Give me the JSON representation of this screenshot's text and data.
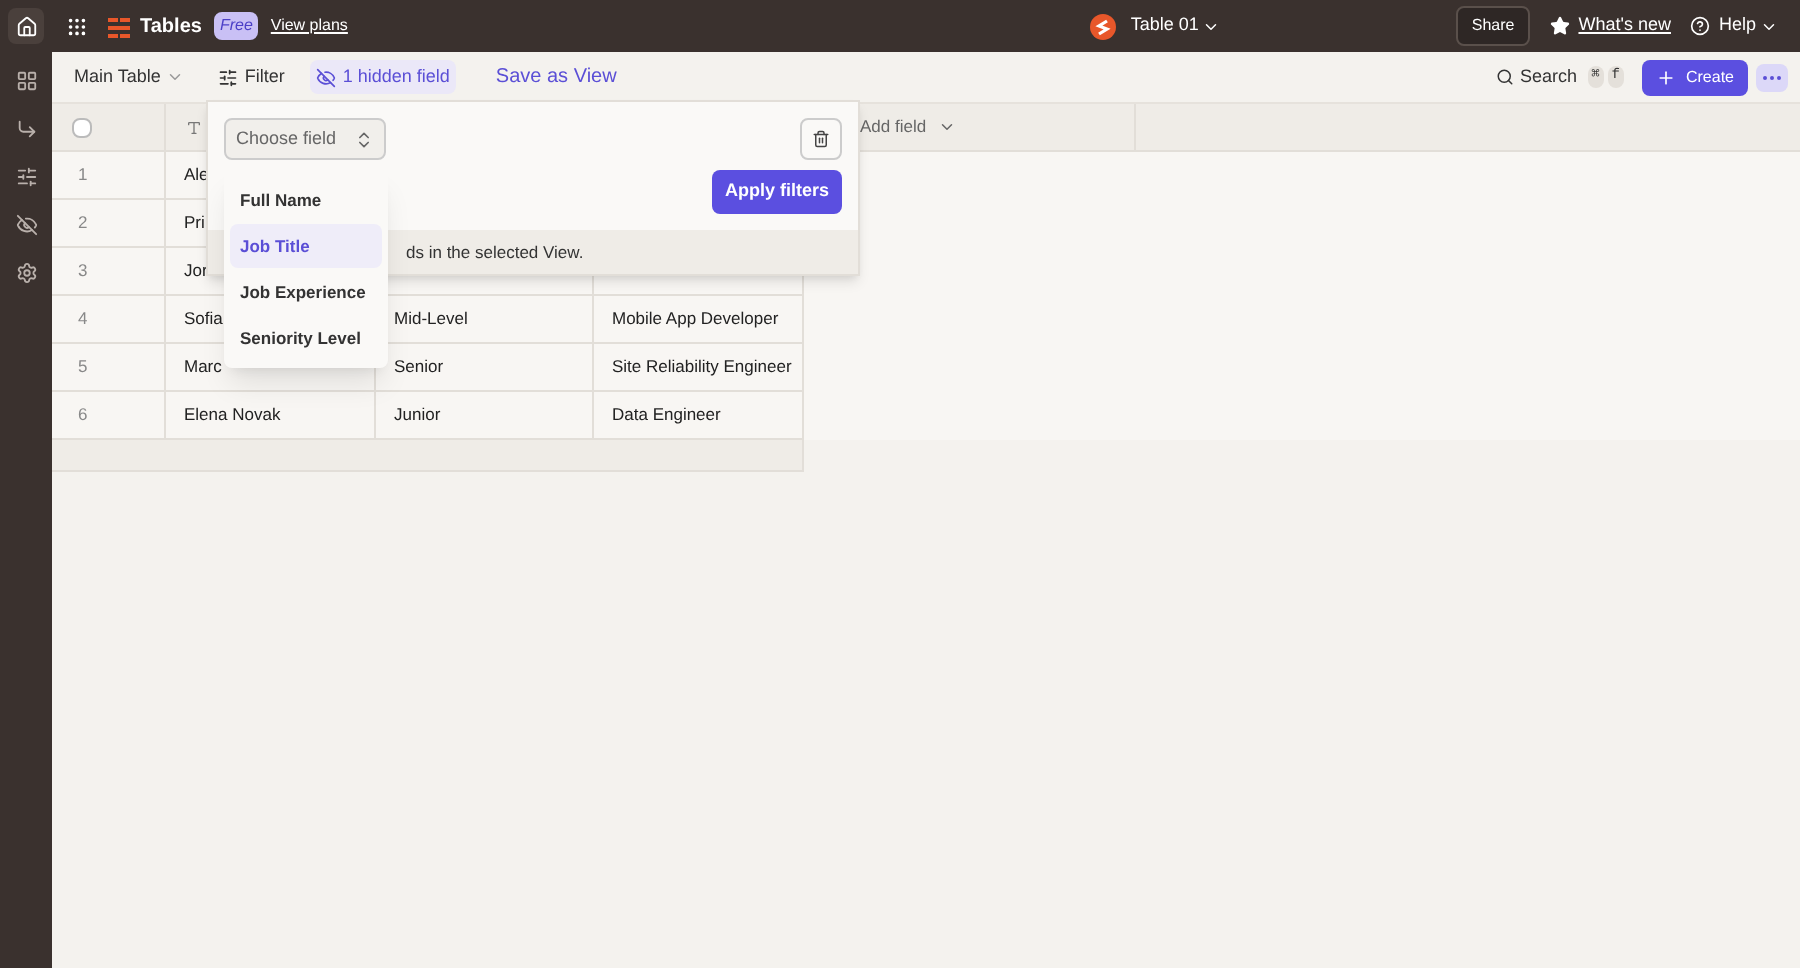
{
  "topbar": {
    "app_name": "Tables",
    "plan_badge": "Free",
    "plans_link": "View plans",
    "table_name": "Table 01",
    "share_button": "Share",
    "whats_new_link": "What's new",
    "help_menu": "Help"
  },
  "toolbar": {
    "view_menu": "Main Table",
    "filter_button": "Filter",
    "hidden_fields_button": "1 hidden field",
    "save_view_button": "Save as View",
    "search_button": "Search",
    "shortcut_keys": [
      "⌘",
      "f"
    ],
    "create_button": "Create"
  },
  "table": {
    "select_all": {
      "checked": false
    },
    "add_field": "Add field",
    "rows": [
      {
        "number": "1",
        "name": "Ale"
      },
      {
        "number": "2",
        "name": "Pri"
      },
      {
        "number": "3",
        "name": "Jor"
      },
      {
        "number": "4",
        "name": "Sofia",
        "seniority": "Mid-Level",
        "job_title": "Mobile App Developer"
      },
      {
        "number": "5",
        "name": "Marc",
        "seniority": "Senior",
        "job_title": "Site Reliability Engineer"
      },
      {
        "number": "6",
        "name": "Elena Novak",
        "seniority": "Junior",
        "job_title": "Data Engineer"
      }
    ]
  },
  "filter_popover": {
    "field_select": "Choose field",
    "apply_button": "Apply filters",
    "note": "ds in the selected View.",
    "options": [
      {
        "label": "Full Name",
        "selected": false
      },
      {
        "label": "Job Title",
        "selected": true
      },
      {
        "label": "Job Experience",
        "selected": false
      },
      {
        "label": "Seniority Level",
        "selected": false
      }
    ]
  }
}
